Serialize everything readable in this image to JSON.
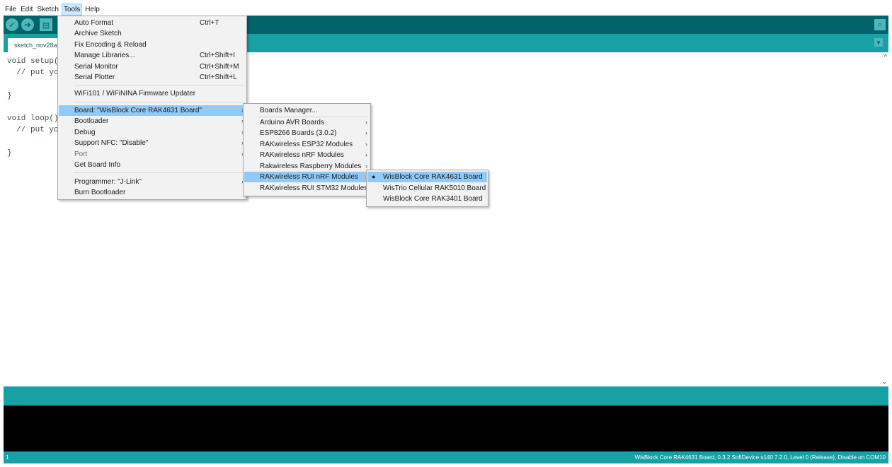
{
  "menubar": {
    "items": [
      "File",
      "Edit",
      "Sketch",
      "Tools",
      "Help"
    ],
    "active": "Tools"
  },
  "toolbar": {
    "verify_icon": "checkmark",
    "upload_icon": "arrow-right",
    "new_icon": "document",
    "serial_monitor_icon": "magnifier"
  },
  "tab": {
    "label": "sketch_nov28a",
    "menu_icon": "chevron-down"
  },
  "code": "void setup() {\n  // put your setup code here, to run once:\n\n}\n\nvoid loop() {\n  // put your main code here, to run repeatedly:\n\n}",
  "tools_menu": {
    "auto_format": {
      "label": "Auto Format",
      "shortcut": "Ctrl+T"
    },
    "archive_sketch": {
      "label": "Archive Sketch"
    },
    "fix_encoding": {
      "label": "Fix Encoding & Reload"
    },
    "manage_libraries": {
      "label": "Manage Libraries...",
      "shortcut": "Ctrl+Shift+I"
    },
    "serial_monitor": {
      "label": "Serial Monitor",
      "shortcut": "Ctrl+Shift+M"
    },
    "serial_plotter": {
      "label": "Serial Plotter",
      "shortcut": "Ctrl+Shift+L"
    },
    "firmware_updater": {
      "label": "WiFi101 / WiFiNINA Firmware Updater"
    },
    "board": {
      "label": "Board: \"WisBlock Core RAK4631 Board\""
    },
    "bootloader": {
      "label": "Bootloader"
    },
    "debug": {
      "label": "Debug"
    },
    "support_nfc": {
      "label": "Support NFC: \"Disable\""
    },
    "port": {
      "label": "Port"
    },
    "get_board_info": {
      "label": "Get Board Info"
    },
    "programmer": {
      "label": "Programmer: \"J-Link\""
    },
    "burn_bootloader": {
      "label": "Burn Bootloader"
    }
  },
  "board_menu": {
    "boards_manager": "Boards Manager...",
    "arduino_avr": "Arduino AVR Boards",
    "esp8266": "ESP8266 Boards (3.0.2)",
    "rak_esp32": "RAKwireless ESP32 Modules",
    "rak_nrf": "RAKwireless nRF Modules",
    "rak_rpi": "Rakwireless Raspberry Modules",
    "rak_rui_nrf": "RAKwireless RUI nRF Modules",
    "rak_rui_stm32": "RAKwireless RUI STM32 Modules"
  },
  "rui_nrf_menu": {
    "rak4631": "WisBlock Core RAK4631 Board",
    "rak5010": "WisTrio Cellular RAK5010 Board",
    "rak3401": "WisBlock Core RAK3401 Board",
    "selected_marker": "●"
  },
  "statusbar": {
    "line": "1",
    "board_info": "WisBlock Core RAK4631 Board, 0.3.2 SoftDevice s140 7.2.0, Level 0 (Release), Disable on COM10"
  },
  "colors": {
    "toolbar": "#006468",
    "accent": "#17a1a5",
    "highlight": "#91c9f7"
  }
}
